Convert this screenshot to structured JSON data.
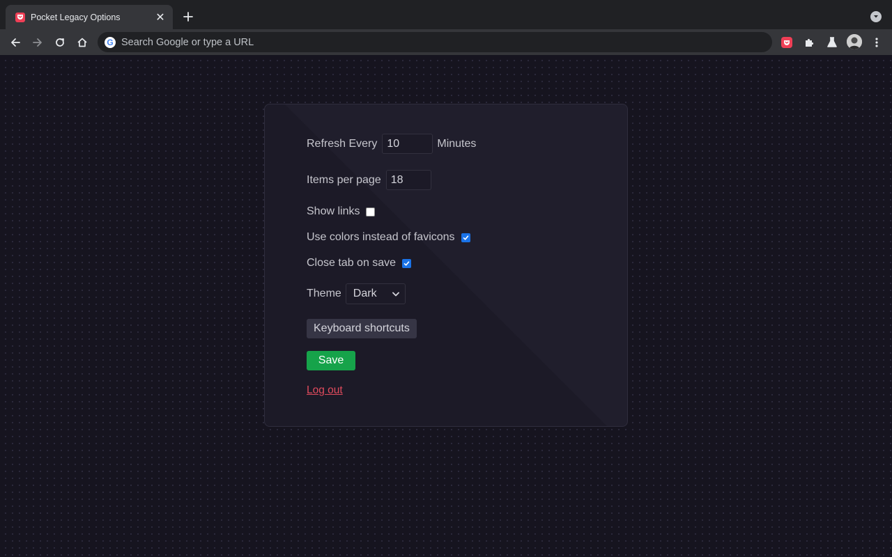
{
  "browser": {
    "tab_title": "Pocket Legacy Options",
    "tab_close": "✕",
    "omnibox_placeholder": "Search Google or type a URL",
    "google_letter": "G"
  },
  "options": {
    "refresh_label": "Refresh Every",
    "refresh_value": "10",
    "refresh_unit": "Minutes",
    "items_label": "Items per page",
    "items_value": "18",
    "show_links_label": "Show links",
    "show_links_checked": false,
    "colors_label": "Use colors instead of favicons",
    "colors_checked": true,
    "close_tab_label": "Close tab on save",
    "close_tab_checked": true,
    "theme_label": "Theme",
    "theme_value": "Dark",
    "keyboard_shortcuts_label": "Keyboard shortcuts",
    "save_label": "Save",
    "logout_label": "Log out"
  },
  "colors": {
    "page_bg": "#16141f",
    "accent_save": "#16a34a",
    "accent_logout": "#e04b5d",
    "checkbox_checked": "#1a73e8",
    "pocket_brand": "#ef3f56"
  },
  "icons": [
    "pocket-icon",
    "close-icon",
    "plus-icon",
    "chevron-down-icon",
    "back-arrow-icon",
    "forward-arrow-icon",
    "reload-icon",
    "home-icon",
    "google-icon",
    "puzzle-icon",
    "flask-icon",
    "kebab-menu-icon",
    "check-icon"
  ]
}
